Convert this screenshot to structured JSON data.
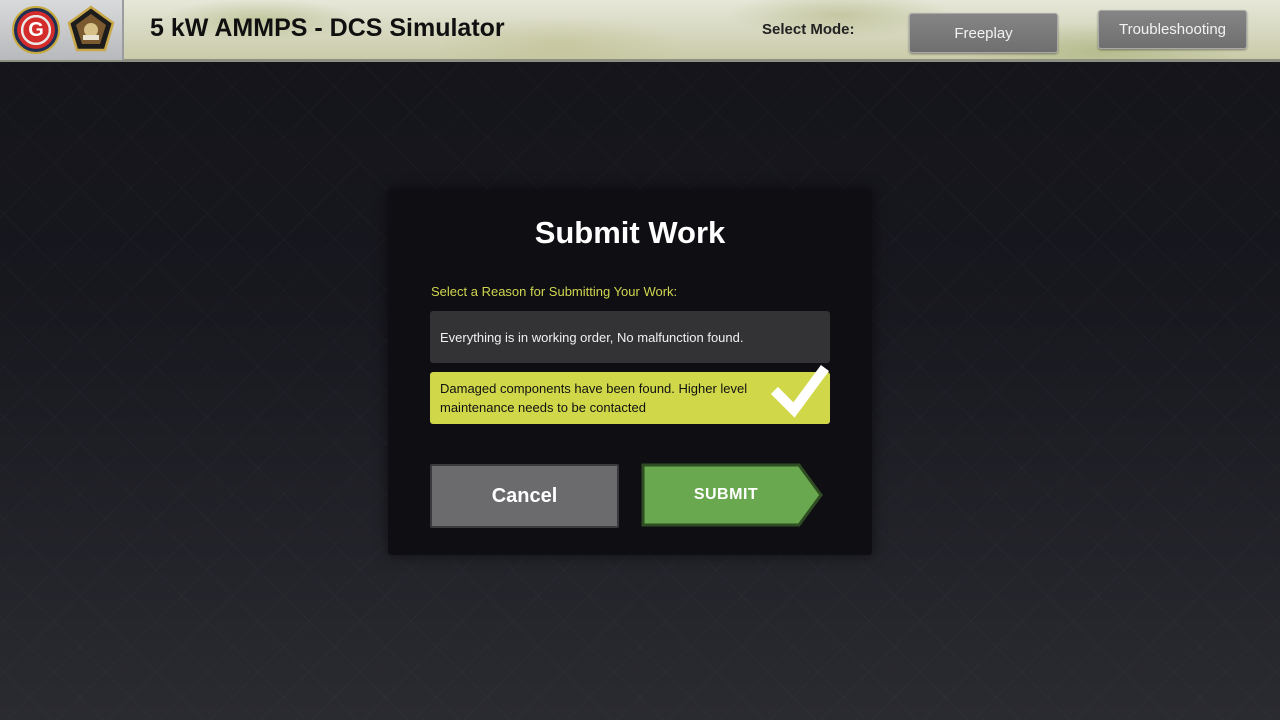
{
  "header": {
    "title": "5 kW AMMPS - DCS Simulator",
    "logo_letter": "G",
    "mode_label": "Select Mode:",
    "modes": [
      "Freeplay",
      "Troubleshooting"
    ]
  },
  "dialog": {
    "title": "Submit Work",
    "prompt": "Select a Reason for Submitting Your Work:",
    "options": [
      {
        "text": "Everything is in working order, No malfunction found.",
        "selected": false
      },
      {
        "text": "Damaged components have been found. Higher level maintenance needs to be contacted",
        "selected": true
      }
    ],
    "cancel_label": "Cancel",
    "submit_label": "SUBMIT"
  },
  "colors": {
    "accent_yellow": "#d0d84a",
    "submit_green": "#6aa84f",
    "dialog_bg": "#0e0e13"
  }
}
